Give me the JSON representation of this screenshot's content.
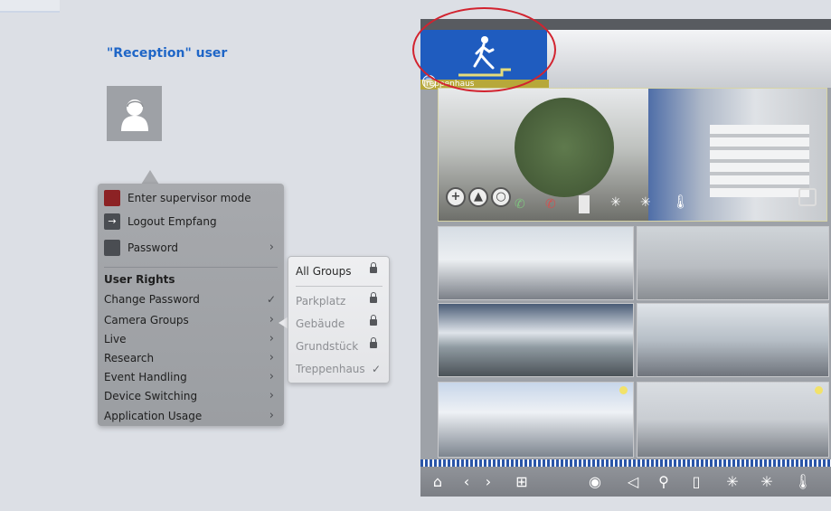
{
  "left": {
    "user_title": "\"Reception\" user"
  },
  "menu": {
    "items": [
      {
        "label": "Enter supervisor mode"
      },
      {
        "label": "Logout Empfang"
      },
      {
        "label": "Password"
      }
    ],
    "section_title": "User Rights",
    "rights": [
      {
        "label": "Change Password"
      },
      {
        "label": "Camera Groups"
      },
      {
        "label": "Live"
      },
      {
        "label": "Research"
      },
      {
        "label": "Event Handling"
      },
      {
        "label": "Device Switching"
      },
      {
        "label": "Application Usage"
      }
    ]
  },
  "submenu": {
    "items": [
      {
        "label": "All Groups"
      },
      {
        "label": "Parkplatz"
      },
      {
        "label": "Gebäude"
      },
      {
        "label": "Grundstück"
      },
      {
        "label": "Treppenhaus"
      }
    ]
  },
  "panel": {
    "group_label": "Treppenhaus"
  },
  "icons": {
    "user_avatar": "user-silhouette-icon",
    "supervisor": "supervisor-icon",
    "logout": "logout-icon",
    "password": "lock-icon",
    "group_tile": "walking-person-icon",
    "toolbar": [
      "home-icon",
      "back-icon",
      "forward-icon",
      "layout-icon",
      "camera-dome-icon",
      "speaker-icon",
      "microphone-icon",
      "door-icon",
      "light-icon",
      "light-off-icon",
      "thermometer-icon"
    ]
  },
  "colors": {
    "accent": "#1f66c7",
    "group_tile": "#1f5cbf",
    "highlight_circle": "#d2232f"
  }
}
